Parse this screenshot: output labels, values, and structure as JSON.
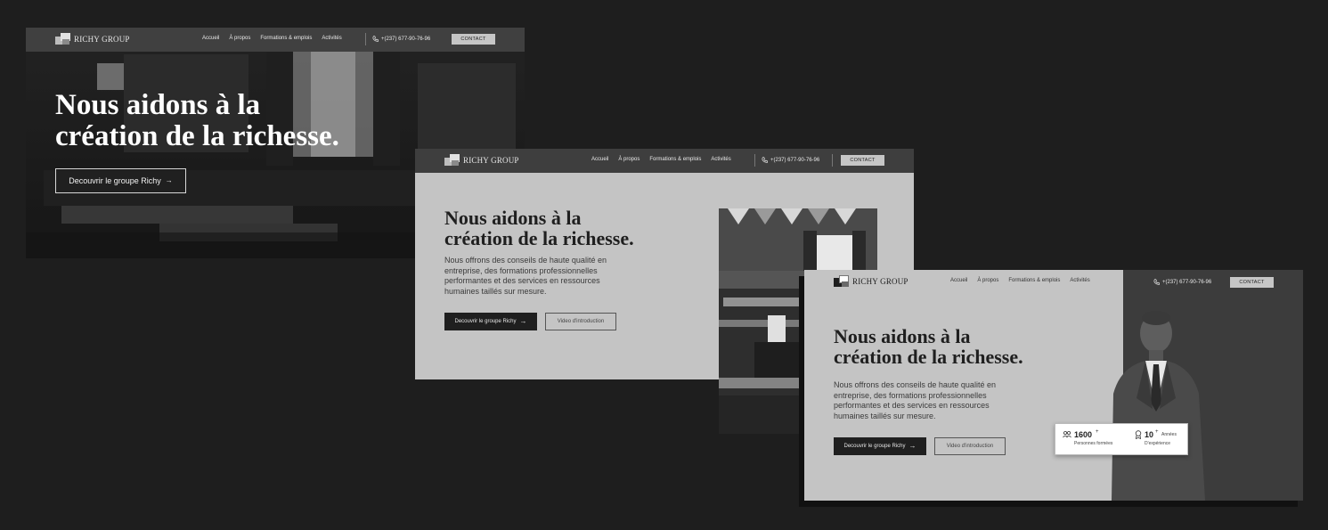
{
  "brand": {
    "name": "RICHY GROUP"
  },
  "nav": {
    "items": [
      "Accueil",
      "À propos",
      "Formations & emplois",
      "Activités"
    ],
    "phone": "+(237) 677-90-76-96",
    "contact": "CONTACT"
  },
  "hero": {
    "title_line1": "Nous aidons à la",
    "title_line2": "création de la richesse.",
    "description": "Nous offrons des conseils de haute qualité en entreprise, des formations professionnelles performantes et des services en ressources humaines taillés sur mesure.",
    "cta_primary": "Decouvrir le groupe Richy",
    "cta_secondary": "Video d'introduction"
  },
  "stats": {
    "trained_value": "1600",
    "trained_suffix": "+",
    "trained_label": "Personnes formées",
    "years_value": "10",
    "years_suffix": "+",
    "years_label_1": "Années",
    "years_label_2": "D'expérience"
  },
  "colors": {
    "background": "#1e1e1e",
    "nav": "#3e3e3e",
    "hero_light": "#c4c4c4",
    "button_dark": "#1f1f1f",
    "contact_button": "#c6c6c6"
  },
  "icons": [
    "logo-mark",
    "phone-icon",
    "arrow-right-icon",
    "people-icon",
    "award-icon"
  ]
}
